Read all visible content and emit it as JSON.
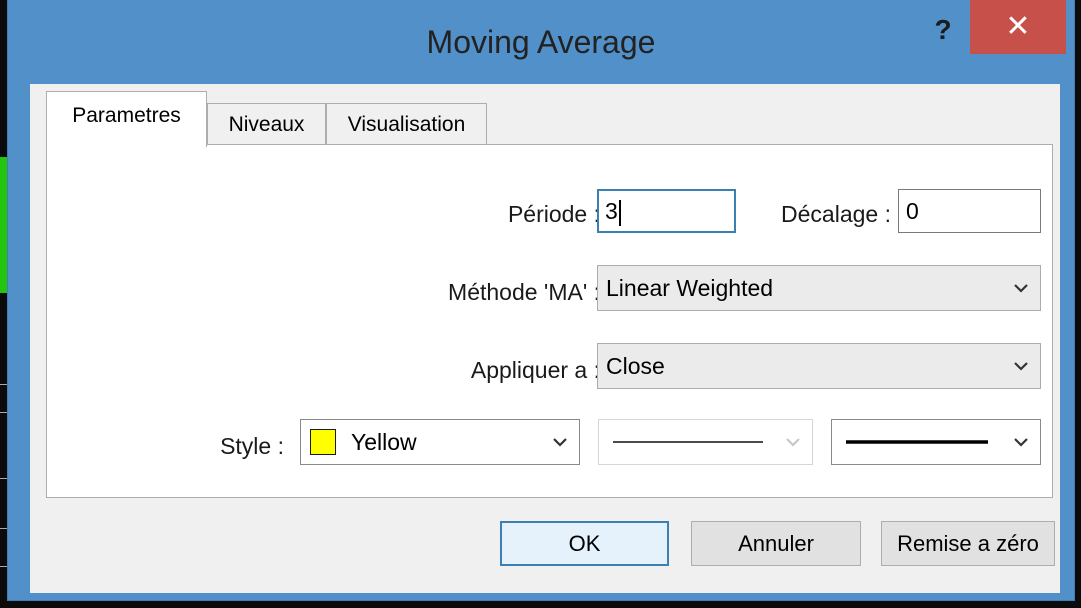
{
  "window": {
    "title": "Moving Average",
    "help_label": "?",
    "close_label": "✕"
  },
  "tabs": [
    {
      "label": "Parametres",
      "active": true
    },
    {
      "label": "Niveaux",
      "active": false
    },
    {
      "label": "Visualisation",
      "active": false
    }
  ],
  "parameters": {
    "period_label": "Période :",
    "period_value": "3",
    "shift_label": "Décalage :",
    "shift_value": "0",
    "method_label": "Méthode 'MA' :",
    "method_value": "Linear Weighted",
    "apply_label": "Appliquer a :",
    "apply_value": "Close",
    "style_label": "Style :",
    "color_name": "Yellow",
    "color_hex": "#ffff00"
  },
  "buttons": {
    "ok": "OK",
    "cancel": "Annuler",
    "reset": "Remise a zéro"
  },
  "colors": {
    "titlebar": "#5190c9",
    "close_button": "#c7504b",
    "focus_border": "#3c7fb1"
  }
}
